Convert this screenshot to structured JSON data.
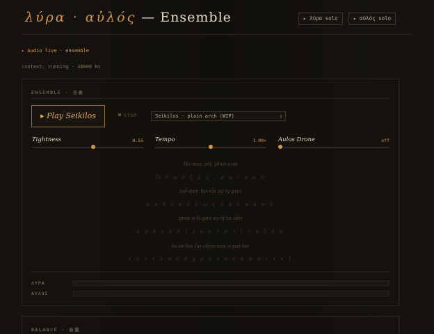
{
  "header": {
    "title_greek": "λύρα · αὐλός",
    "title_suffix": " — Ensemble",
    "buttons": [
      "▸ λύρα solo",
      "▸ αὐλός solo"
    ]
  },
  "status": {
    "audio_line": "▸ Audio live · ensemble",
    "context_line": "context: running · 48000 Hz"
  },
  "ensemble": {
    "heading": "ENSEMBLE · 合奏",
    "play_label": "▸ Play Seikilos",
    "stop_label": "STOP",
    "select_value": "Seikilos · plain arch (WIP)",
    "sliders": [
      {
        "label": "Tightness",
        "value": "0.55",
        "level": 0.55
      },
      {
        "label": "Tempo",
        "value": "1.00×",
        "level": 0.5
      },
      {
        "label": "Aulos Drone",
        "value": "off",
        "level": 0.0
      }
    ],
    "lyrics": [
      "Ho-son zêi, phai-nou",
      "Ὅ σ ο ν   ζ ῇ ς ,   φ α ί ν ο υ",
      "mê-den ho-lôs sy ly-pou",
      "μ η δ ὲ ν   ὅ λ ω ς   σ ὺ   λ υ π ο ῦ",
      "pros o-li-gon es-ti to zên",
      "π ρ ὸ ς   ὀ λ ί γ ο ν   ἐ σ τ ὶ   τ ὸ   ζ ῆ ν",
      "to te-los ho chro-nos a-pai-tei",
      "τ ὸ   τ έ λ ο ς   ὁ   χ ρ ό ν ο ς   ἀ π α ι τ ε ῖ"
    ],
    "meters": [
      {
        "label": "ΛΥΡΑ",
        "level": 0.0
      },
      {
        "label": "ΑΥΛΟΣ",
        "level": 0.0
      }
    ]
  },
  "balance": {
    "heading": "BALANCE · 音量"
  },
  "colors": {
    "accent": "#d8984c",
    "background": "#13100c",
    "border": "#2d271d"
  }
}
